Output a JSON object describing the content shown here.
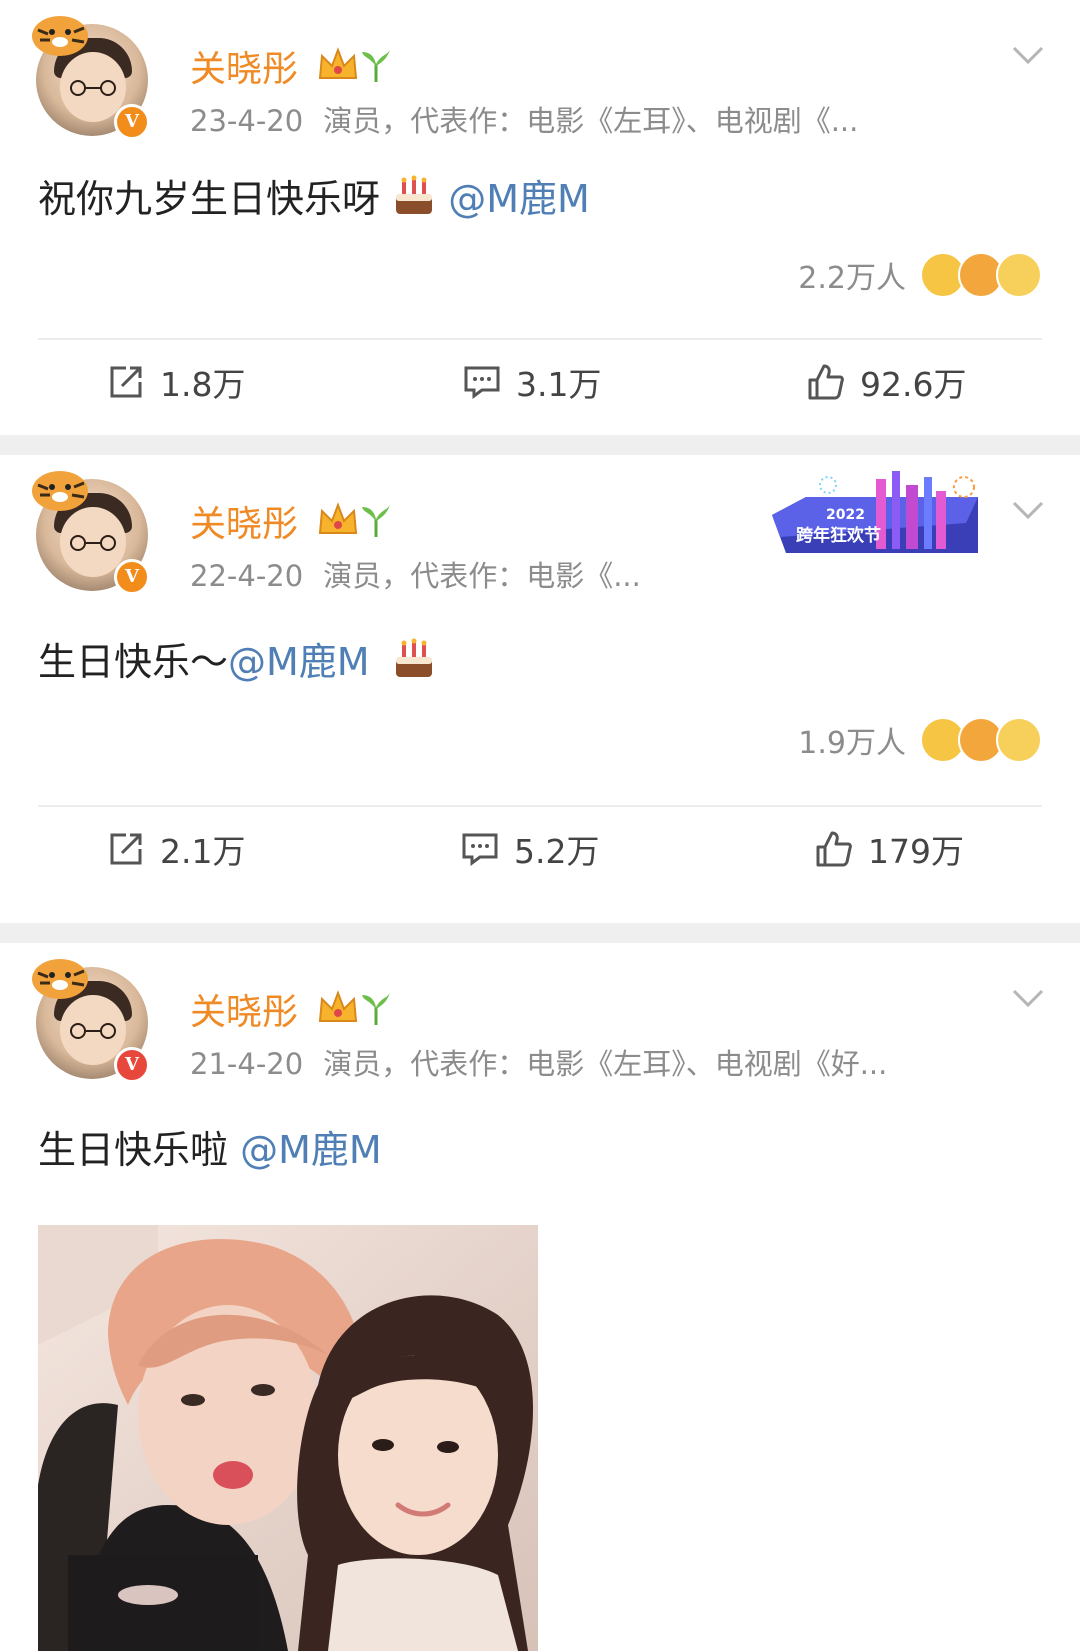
{
  "posts": [
    {
      "username": "关晓彤",
      "date": "23-4-20",
      "source": "演员，代表作：电影《左耳》、电视剧《...",
      "text": "祝你九岁生日快乐呀",
      "text_after": "",
      "mention": "@M鹿M",
      "reaction_count": "2.2万人",
      "repost": "1.8万",
      "comment": "3.1万",
      "like": "92.6万"
    },
    {
      "username": "关晓彤",
      "date": "22-4-20",
      "source": "演员，代表作：电影《...",
      "text": "生日快乐～",
      "mention": "@M鹿M",
      "reaction_count": "1.9万人",
      "repost": "2.1万",
      "comment": "5.2万",
      "like": "179万",
      "promo_year": "2022",
      "promo_text": "跨年狂欢节"
    },
    {
      "username": "关晓彤",
      "date": "21-4-20",
      "source": "演员，代表作：电影《左耳》、电视剧《好...",
      "text": "生日快乐啦",
      "mention": "@M鹿M"
    }
  ],
  "icons": {
    "badge": "crown-icon",
    "sprout": "sprout-icon",
    "cake": "cake-icon",
    "verified": "v-verified-icon",
    "more": "chevron-down-icon",
    "repost": "repost-icon",
    "comment": "comment-icon",
    "like": "thumbs-up-icon"
  },
  "colors": {
    "username": "#f08a24",
    "mention": "#4f7fb5",
    "meta": "#8c8c8c",
    "separator": "#efefef"
  }
}
